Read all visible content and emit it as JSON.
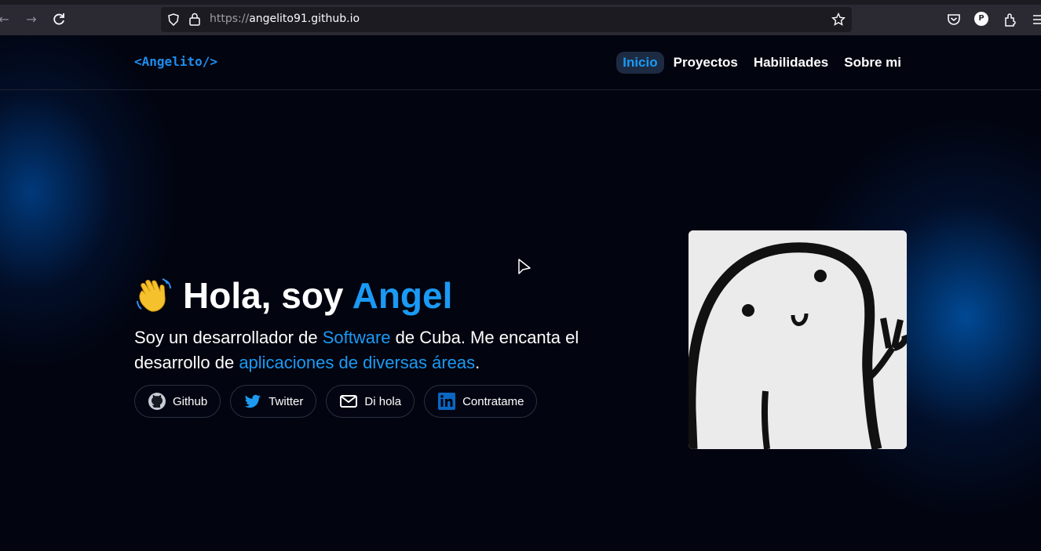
{
  "browser": {
    "url_protocol": "https://",
    "url_host": "angelito91.github.io",
    "account_initial": "P"
  },
  "site": {
    "logo": "<Angelito/>",
    "nav": [
      {
        "label": "Inicio",
        "active": true
      },
      {
        "label": "Proyectos",
        "active": false
      },
      {
        "label": "Habilidades",
        "active": false
      },
      {
        "label": "Sobre mi",
        "active": false
      }
    ]
  },
  "hero": {
    "greeting_prefix": "Hola, soy ",
    "name": "Angel",
    "desc_1": "Soy un desarrollador de ",
    "desc_hl_1": "Software",
    "desc_2": " de Cuba. Me encanta el desarrollo de ",
    "desc_hl_2": "aplicaciones de diversas áreas",
    "desc_3": ".",
    "links": [
      {
        "label": "Github",
        "icon": "github-icon"
      },
      {
        "label": "Twitter",
        "icon": "twitter-icon"
      },
      {
        "label": "Di hola",
        "icon": "mail-icon"
      },
      {
        "label": "Contratame",
        "icon": "linkedin-icon"
      }
    ]
  },
  "colors": {
    "accent": "#1a9af5",
    "background": "#02040f"
  }
}
